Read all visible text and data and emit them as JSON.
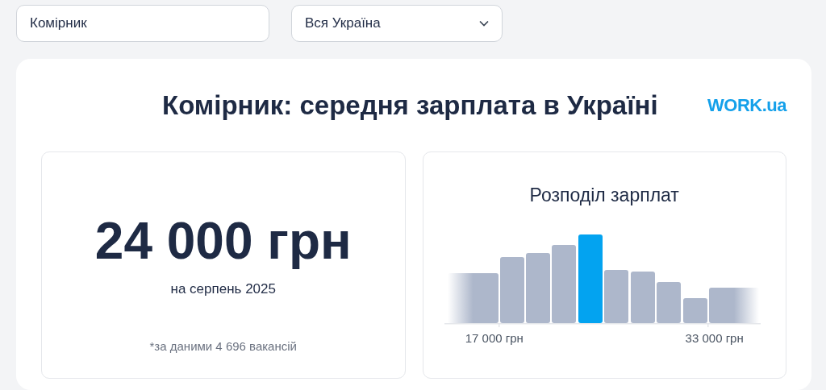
{
  "search": {
    "value": "Комірник"
  },
  "region_select": {
    "value": "Вся Україна"
  },
  "report": {
    "title": "Комірник: середня зарплата в Україні",
    "logo": "WORK.ua",
    "salary": {
      "amount": "24 000 грн",
      "period": "на серпень 2025",
      "note": "*за даними 4 696 вакансій"
    },
    "distribution": {
      "title": "Розподіл зарплат",
      "axis_labels": [
        "17 000 грн",
        "33 000 грн"
      ]
    }
  }
}
